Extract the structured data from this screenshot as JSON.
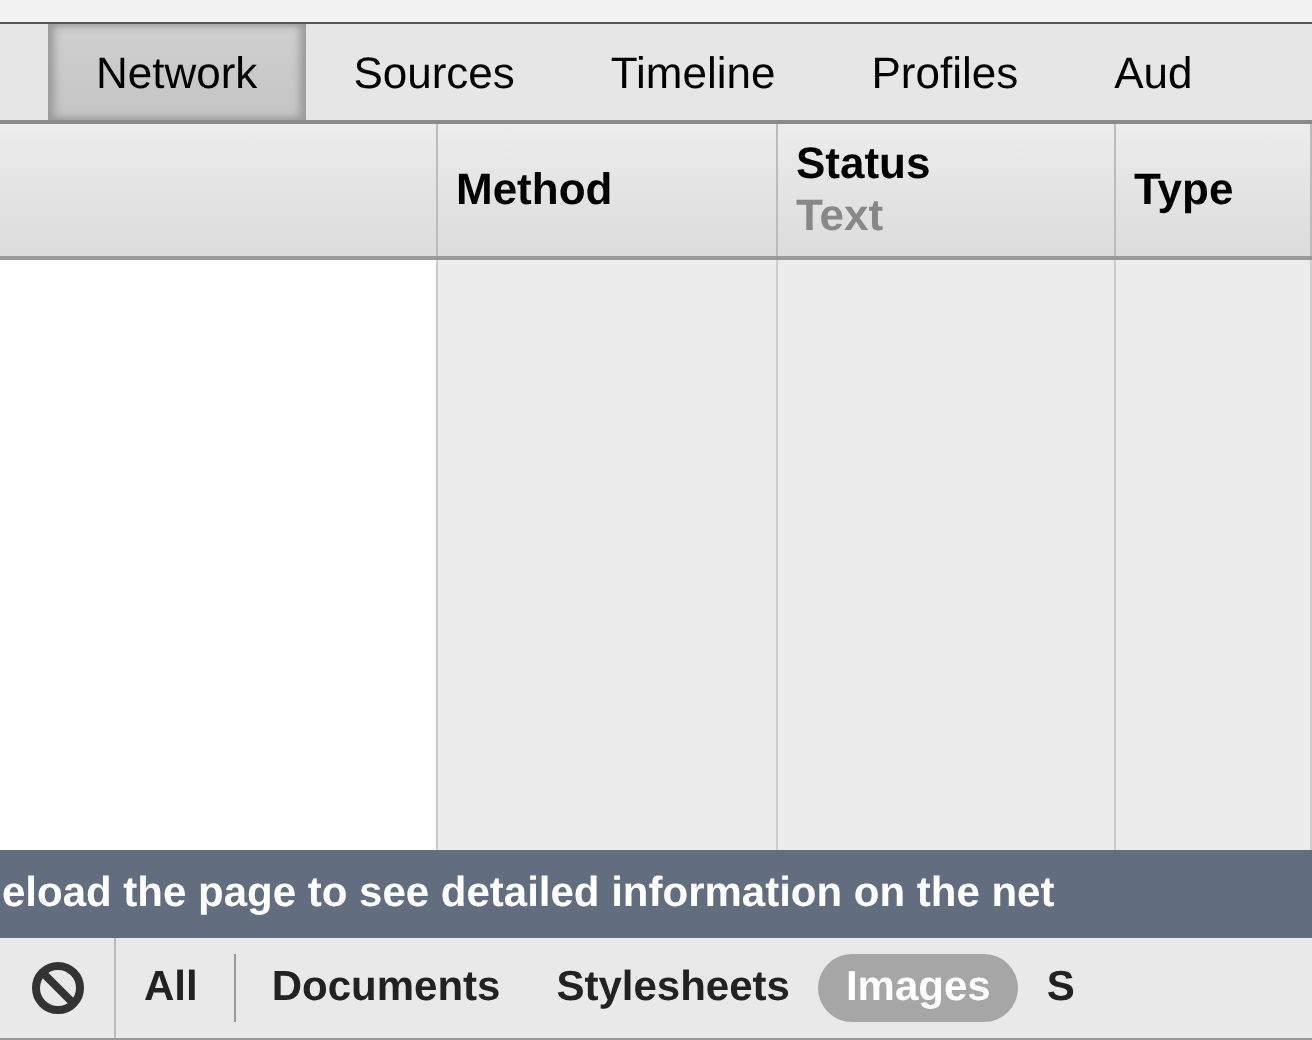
{
  "tabs": [
    {
      "label": "Network",
      "selected": true
    },
    {
      "label": "Sources",
      "selected": false
    },
    {
      "label": "Timeline",
      "selected": false
    },
    {
      "label": "Profiles",
      "selected": false
    },
    {
      "label": "Aud",
      "selected": false
    }
  ],
  "table": {
    "columns": [
      {},
      {
        "label": "Method"
      },
      {
        "label": "Status",
        "sublabel": "Text"
      },
      {
        "label": "Type"
      }
    ]
  },
  "banner": "eload the page to see detailed information on the net",
  "filters": [
    {
      "label": "All",
      "selected": false
    },
    {
      "label": "Documents",
      "selected": false
    },
    {
      "label": "Stylesheets",
      "selected": false
    },
    {
      "label": "Images",
      "selected": true
    },
    {
      "label": "S",
      "selected": false
    }
  ]
}
